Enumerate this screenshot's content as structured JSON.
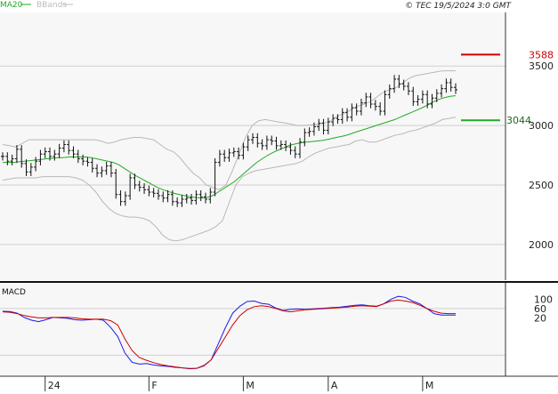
{
  "header": {
    "legend_ma": "MA20",
    "legend_bb": "BBands",
    "timestamp": "© TEC 19/5/2024 3:0 GMT"
  },
  "colors": {
    "ma": "#22aa22",
    "bbands": "#b8b8b8",
    "bars": "#111111",
    "resistance": "#cc0000",
    "support": "#22aa22",
    "macd": "#1a1aee",
    "signal": "#cc0000",
    "grid": "#cfcfcf",
    "panel_bg": "#f7f7f7"
  },
  "chart_data": [
    {
      "type": "ohlc",
      "ylim": [
        1700,
        3950
      ],
      "y_ticks": [
        2000,
        2500,
        3000,
        3500
      ],
      "y_tick_labels": [
        "2000",
        "2500",
        "3000",
        "3500"
      ],
      "x_month_labels": [
        {
          "index": 9,
          "label": "24"
        },
        {
          "index": 31,
          "label": "F"
        },
        {
          "index": 51,
          "label": "M"
        },
        {
          "index": 69,
          "label": "A"
        },
        {
          "index": 89,
          "label": "M"
        }
      ],
      "close": [
        2740,
        2700,
        2720,
        2800,
        2680,
        2610,
        2650,
        2700,
        2760,
        2780,
        2740,
        2760,
        2810,
        2840,
        2790,
        2760,
        2720,
        2700,
        2690,
        2640,
        2600,
        2620,
        2660,
        2600,
        2420,
        2360,
        2410,
        2560,
        2500,
        2480,
        2460,
        2440,
        2430,
        2410,
        2390,
        2420,
        2360,
        2350,
        2380,
        2390,
        2370,
        2420,
        2400,
        2380,
        2440,
        2690,
        2760,
        2730,
        2770,
        2780,
        2750,
        2820,
        2880,
        2900,
        2850,
        2830,
        2880,
        2870,
        2830,
        2840,
        2820,
        2790,
        2760,
        2860,
        2940,
        2950,
        2990,
        3020,
        2960,
        3030,
        3060,
        3050,
        3110,
        3070,
        3150,
        3120,
        3190,
        3240,
        3180,
        3160,
        3120,
        3260,
        3310,
        3390,
        3350,
        3330,
        3290,
        3200,
        3220,
        3260,
        3180,
        3230,
        3270,
        3310,
        3360,
        3320,
        3300
      ],
      "ma20": [
        2690,
        2690,
        2690,
        2695,
        2700,
        2705,
        2710,
        2715,
        2720,
        2725,
        2730,
        2730,
        2735,
        2735,
        2735,
        2735,
        2730,
        2720,
        2710,
        2700,
        2690,
        2670,
        2640,
        2610,
        2580,
        2555,
        2530,
        2505,
        2480,
        2460,
        2445,
        2430,
        2420,
        2410,
        2400,
        2395,
        2390,
        2395,
        2410,
        2440,
        2470,
        2500,
        2530,
        2570,
        2610,
        2650,
        2690,
        2720,
        2750,
        2775,
        2795,
        2815,
        2835,
        2845,
        2855,
        2860,
        2865,
        2870,
        2875,
        2885,
        2895,
        2905,
        2915,
        2930,
        2945,
        2960,
        2975,
        2990,
        3005,
        3020,
        3035,
        3050,
        3070,
        3090,
        3110,
        3130,
        3150,
        3175,
        3200,
        3220,
        3235,
        3245,
        3250
      ],
      "bb_upper": [
        2840,
        2830,
        2820,
        2850,
        2880,
        2880,
        2880,
        2880,
        2880,
        2880,
        2880,
        2880,
        2880,
        2880,
        2880,
        2870,
        2850,
        2860,
        2880,
        2890,
        2900,
        2900,
        2890,
        2880,
        2840,
        2800,
        2780,
        2730,
        2660,
        2600,
        2560,
        2500,
        2480,
        2460,
        2500,
        2620,
        2760,
        2900,
        3000,
        3040,
        3050,
        3040,
        3030,
        3020,
        3010,
        3000,
        3000,
        3005,
        3010,
        3020,
        3040,
        3080,
        3100,
        3130,
        3160,
        3180,
        3200,
        3240,
        3280,
        3300,
        3320,
        3360,
        3400,
        3420,
        3430,
        3440,
        3450,
        3460,
        3460,
        3460
      ],
      "bb_lower": [
        2540,
        2550,
        2560,
        2560,
        2560,
        2560,
        2570,
        2570,
        2570,
        2570,
        2570,
        2560,
        2540,
        2500,
        2440,
        2360,
        2300,
        2260,
        2240,
        2230,
        2230,
        2220,
        2200,
        2150,
        2080,
        2040,
        2030,
        2040,
        2060,
        2080,
        2100,
        2120,
        2150,
        2200,
        2350,
        2500,
        2570,
        2600,
        2620,
        2630,
        2640,
        2650,
        2660,
        2670,
        2680,
        2700,
        2740,
        2770,
        2790,
        2810,
        2820,
        2830,
        2840,
        2870,
        2880,
        2860,
        2860,
        2880,
        2900,
        2920,
        2930,
        2950,
        2960,
        2980,
        3000,
        3020,
        3050,
        3060,
        3070
      ],
      "resistance": {
        "value": 3588,
        "label": "3588"
      },
      "support": {
        "value": 3044,
        "label": "3044"
      }
    },
    {
      "type": "line",
      "title": "MACD",
      "ylim": [
        -230,
        170
      ],
      "y_ticks": [
        100,
        60,
        20
      ],
      "y_tick_labels": [
        "100",
        "60",
        "20"
      ],
      "series": [
        {
          "role": "macd",
          "values": [
            48,
            47,
            40,
            22,
            10,
            4,
            12,
            22,
            20,
            18,
            12,
            10,
            12,
            14,
            10,
            -20,
            -60,
            -130,
            -170,
            -178,
            -176,
            -182,
            -186,
            -188,
            -192,
            -194,
            -198,
            -196,
            -184,
            -160,
            -90,
            -20,
            40,
            70,
            90,
            92,
            82,
            78,
            62,
            52,
            56,
            58,
            56,
            58,
            60,
            62,
            64,
            66,
            70,
            74,
            76,
            72,
            70,
            80,
            100,
            112,
            108,
            92,
            80,
            60,
            38,
            32,
            32,
            32
          ]
        },
        {
          "role": "signal",
          "values": [
            46,
            44,
            38,
            30,
            24,
            20,
            20,
            22,
            22,
            22,
            20,
            16,
            14,
            14,
            14,
            8,
            -10,
            -70,
            -120,
            -150,
            -162,
            -172,
            -180,
            -186,
            -190,
            -194,
            -197,
            -196,
            -186,
            -160,
            -110,
            -60,
            -10,
            30,
            55,
            68,
            72,
            68,
            60,
            50,
            46,
            50,
            54,
            56,
            58,
            60,
            62,
            64,
            66,
            70,
            72,
            70,
            68,
            80,
            92,
            96,
            92,
            86,
            74,
            60,
            48,
            40,
            38,
            38
          ]
        }
      ]
    }
  ]
}
